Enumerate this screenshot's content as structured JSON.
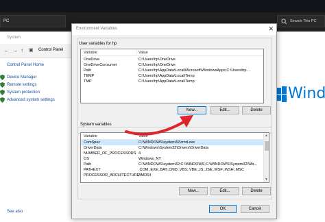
{
  "explorer": {
    "address": "PC",
    "search_placeholder": "Search This PC",
    "window_title": "System",
    "breadcrumb": "Control Panel",
    "control_panel_home": "Control Panel Home",
    "links": [
      "Device Manager",
      "Remote settings",
      "System protection",
      "Advanced system settings"
    ],
    "bottom_link": "See also",
    "windows_logo_text": "Windo"
  },
  "dialog": {
    "title": "Environment Variables",
    "close_glyph": "✕",
    "user_group_label": "User variables for hp",
    "system_group_label": "System variables",
    "columns": {
      "variable": "Variable",
      "value": "Value"
    },
    "user_vars": [
      {
        "variable": "OneDrive",
        "value": "C:\\Users\\hp\\OneDrive"
      },
      {
        "variable": "OneDriveConsumer",
        "value": "C:\\Users\\hp\\OneDrive"
      },
      {
        "variable": "Path",
        "value": "C:\\Users\\hp\\AppData\\Local\\Microsoft\\WindowsApps;C:\\Users\\hp..."
      },
      {
        "variable": "TEMP",
        "value": "C:\\Users\\hp\\AppData\\Local\\Temp"
      },
      {
        "variable": "TMP",
        "value": "C:\\Users\\hp\\AppData\\Local\\Temp"
      }
    ],
    "system_vars": [
      {
        "variable": "ComSpec",
        "value": "C:\\WINDOWS\\system32\\cmd.exe"
      },
      {
        "variable": "DriverData",
        "value": "C:\\Windows\\System32\\Drivers\\DriverData"
      },
      {
        "variable": "NUMBER_OF_PROCESSORS",
        "value": "4"
      },
      {
        "variable": "OS",
        "value": "Windows_NT"
      },
      {
        "variable": "Path",
        "value": "C:\\WINDOWS\\system32;C:\\WINDOWS;C:\\WINDOWS\\System32\\Wb..."
      },
      {
        "variable": "PATHEXT",
        "value": ".COM;.EXE;.BAT;.CMD;.VBS;.VBE;.JS;.JSE;.WSF;.WSH;.MSC"
      },
      {
        "variable": "PROCESSOR_ARCHITECTURE",
        "value": "AMD64"
      }
    ],
    "buttons": {
      "user_new": "New...",
      "user_edit": "Edit...",
      "user_delete": "Delete",
      "sys_new": "New...",
      "sys_edit": "Edit...",
      "sys_delete": "Delete",
      "ok": "OK",
      "cancel": "Cancel"
    }
  },
  "colors": {
    "arrow": "#e0242b",
    "selection": "#cce8ff",
    "link": "#1a4ea0",
    "windows_blue": "#0078d4"
  }
}
